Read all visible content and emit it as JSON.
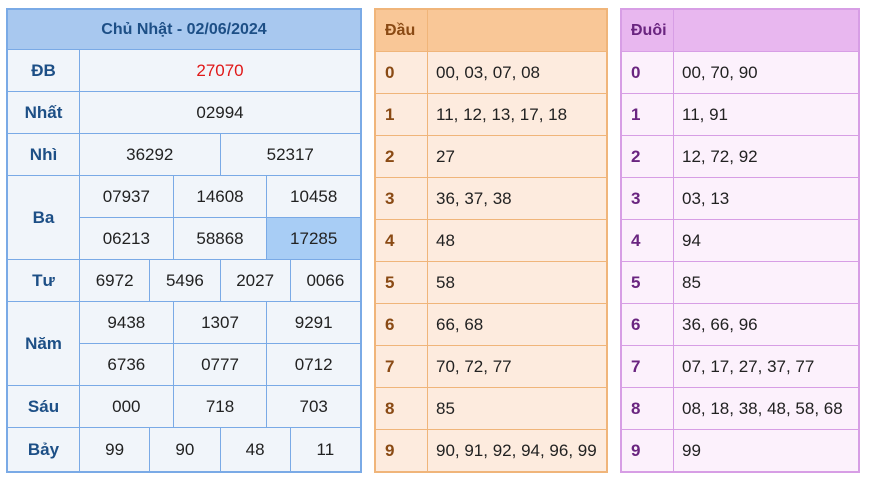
{
  "results": {
    "title": "Chủ Nhật - 02/06/2024",
    "prizes": [
      {
        "label": "ĐB",
        "rows": [
          [
            "27070"
          ]
        ]
      },
      {
        "label": "Nhất",
        "rows": [
          [
            "02994"
          ]
        ]
      },
      {
        "label": "Nhì",
        "rows": [
          [
            "36292",
            "52317"
          ]
        ]
      },
      {
        "label": "Ba",
        "rows": [
          [
            "07937",
            "14608",
            "10458"
          ],
          [
            "06213",
            "58868",
            "17285"
          ]
        ]
      },
      {
        "label": "Tư",
        "rows": [
          [
            "6972",
            "5496",
            "2027",
            "0066"
          ]
        ]
      },
      {
        "label": "Năm",
        "rows": [
          [
            "9438",
            "1307",
            "9291"
          ],
          [
            "6736",
            "0777",
            "0712"
          ]
        ]
      },
      {
        "label": "Sáu",
        "rows": [
          [
            "000",
            "718",
            "703"
          ]
        ]
      },
      {
        "label": "Bảy",
        "rows": [
          [
            "99",
            "90",
            "48",
            "11"
          ]
        ]
      }
    ],
    "special_color": "#e01818",
    "highlight_color": "#a8cdf5"
  },
  "dau": {
    "title": "Đầu",
    "rows": [
      {
        "k": "0",
        "v": "00, 03, 07, 08"
      },
      {
        "k": "1",
        "v": "11, 12, 13, 17, 18"
      },
      {
        "k": "2",
        "v": "27"
      },
      {
        "k": "3",
        "v": "36, 37, 38"
      },
      {
        "k": "4",
        "v": "48"
      },
      {
        "k": "5",
        "v": "58"
      },
      {
        "k": "6",
        "v": "66, 68"
      },
      {
        "k": "7",
        "v": "70, 72, 77"
      },
      {
        "k": "8",
        "v": "85"
      },
      {
        "k": "9",
        "v": "90, 91, 92, 94, 96, 99"
      }
    ]
  },
  "duoi": {
    "title": "Đuôi",
    "rows": [
      {
        "k": "0",
        "v": "00, 70, 90"
      },
      {
        "k": "1",
        "v": "11, 91"
      },
      {
        "k": "2",
        "v": "12, 72, 92"
      },
      {
        "k": "3",
        "v": "03, 13"
      },
      {
        "k": "4",
        "v": "94"
      },
      {
        "k": "5",
        "v": "85"
      },
      {
        "k": "6",
        "v": "36, 66, 96"
      },
      {
        "k": "7",
        "v": "07, 17, 27, 37, 77"
      },
      {
        "k": "8",
        "v": "08, 18, 38, 48, 58, 68"
      },
      {
        "k": "9",
        "v": "99"
      }
    ]
  }
}
